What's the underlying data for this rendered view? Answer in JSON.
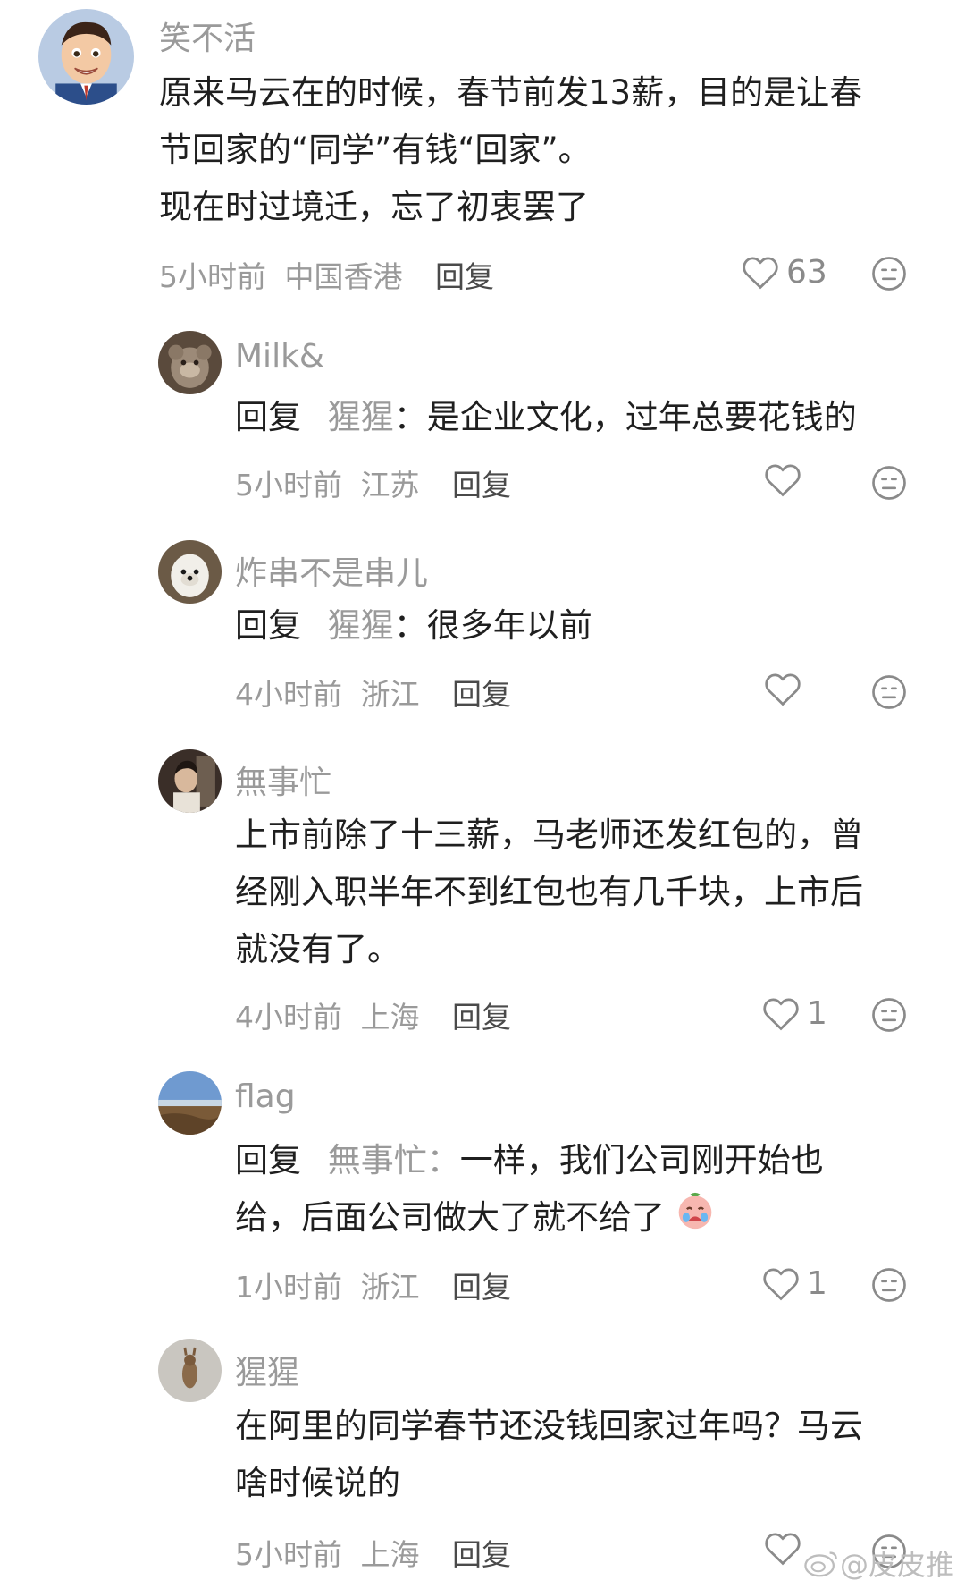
{
  "comments": [
    {
      "username": "笑不活",
      "lines": [
        "原来马云在的时候，春节前发13薪，目的是让春",
        "节回家的“同学”有钱“回家”。",
        "现在时过境迁，忘了初衷罢了"
      ],
      "time": "5小时前",
      "location": "中国香港",
      "reply_label": "回复",
      "likes": "63"
    },
    {
      "username": "Milk&",
      "reply_prefix": "回复",
      "reply_target": "猩猩",
      "reply_sep": "：",
      "text": "是企业文化，过年总要花钱的",
      "time": "5小时前",
      "location": "江苏",
      "reply_label": "回复",
      "likes": ""
    },
    {
      "username": "炸串不是串儿",
      "reply_prefix": "回复",
      "reply_target": "猩猩",
      "reply_sep": "：",
      "text": "很多年以前",
      "time": "4小时前",
      "location": "浙江",
      "reply_label": "回复",
      "likes": ""
    },
    {
      "username": "無事忙",
      "lines": [
        "上市前除了十三薪，马老师还发红包的，曾",
        "经刚入职半年不到红包也有几千块，上市后",
        "就没有了。"
      ],
      "time": "4小时前",
      "location": "上海",
      "reply_label": "回复",
      "likes": "1"
    },
    {
      "username": "flag",
      "reply_prefix": "回复",
      "reply_target": "無事忙",
      "reply_sep": "：",
      "text": "一样，我们公司刚开始也",
      "line2": "给，后面公司做大了就不给了",
      "emoji": "crying-face-emoji",
      "time": "1小时前",
      "location": "浙江",
      "reply_label": "回复",
      "likes": "1"
    },
    {
      "username": "猩猩",
      "lines": [
        "在阿里的同学春节还没钱回家过年吗？马云",
        "啥时候说的"
      ],
      "time": "5小时前",
      "location": "上海",
      "reply_label": "回复",
      "likes": ""
    }
  ],
  "watermark": {
    "text": "@皮皮推",
    "icon": "weibo-logo-icon"
  },
  "colors": {
    "text": "#1f1f1f",
    "muted": "#9a9a9a",
    "icon": "#8a8a8a"
  }
}
